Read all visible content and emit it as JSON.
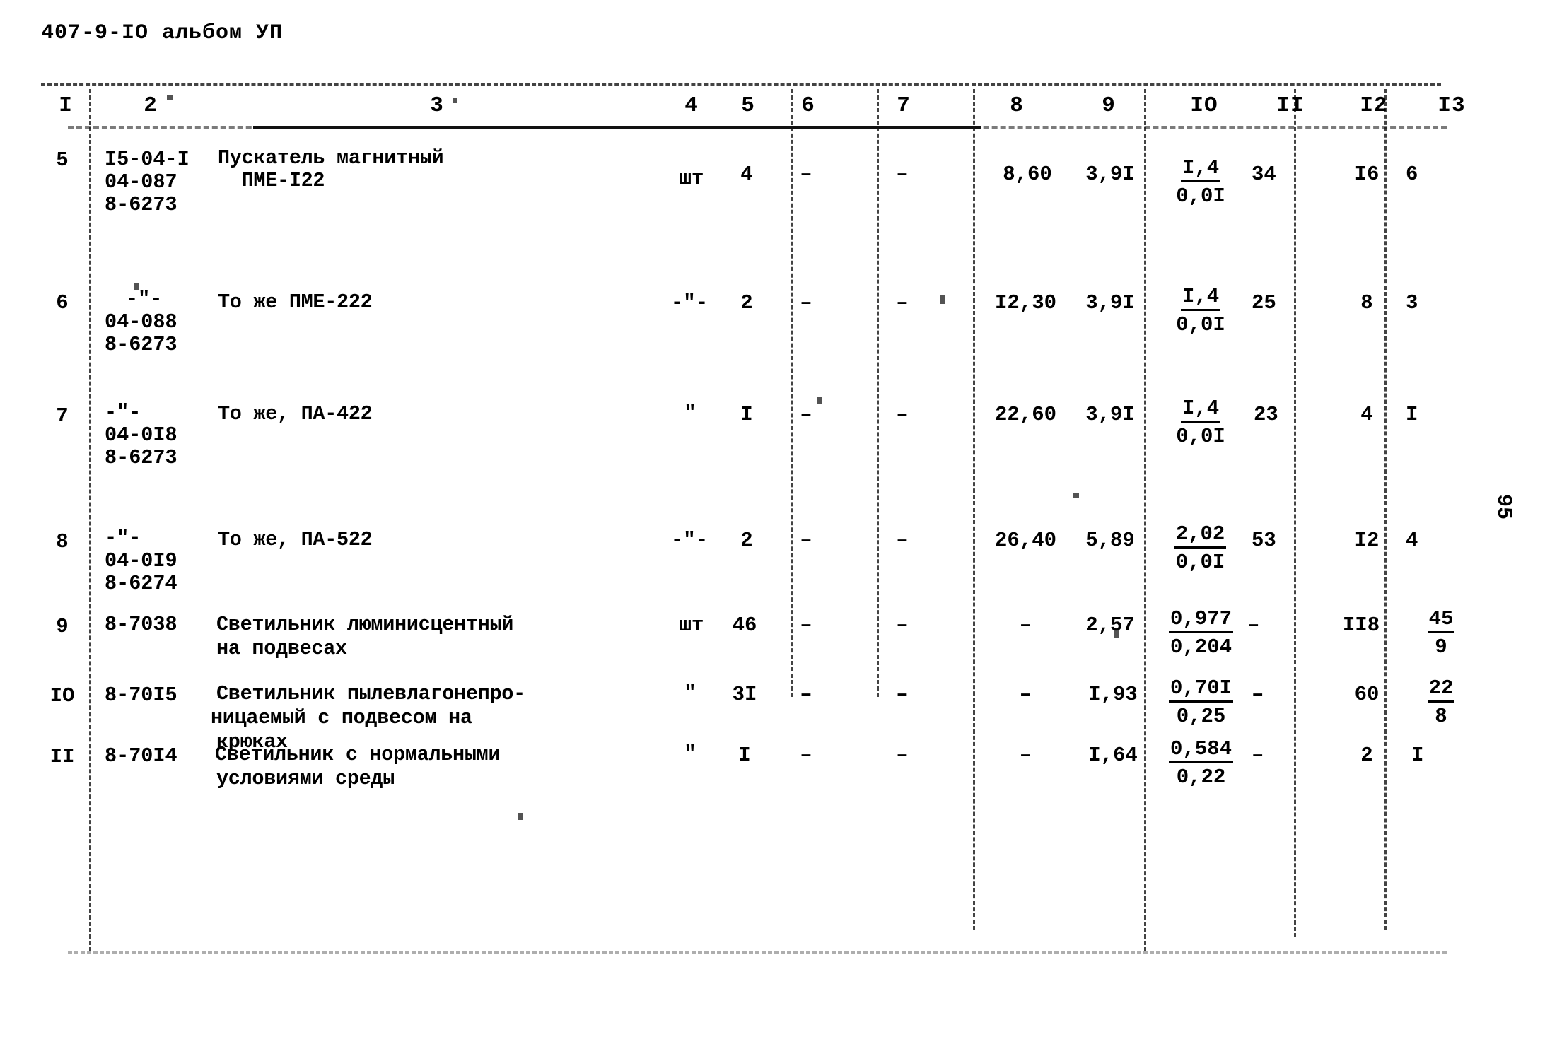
{
  "document": {
    "heading": "407-9-IO альбом УП",
    "page_number": "95"
  },
  "table": {
    "column_headers": [
      "I",
      "2",
      "3",
      "4",
      "5",
      "6",
      "7",
      "8",
      "9",
      "IO",
      "II",
      "I2",
      "I3"
    ],
    "rows": [
      {
        "n": "5",
        "codes": [
          "I5-04-I",
          "04-087",
          "8-6273"
        ],
        "description": [
          "Пускатель магнитный",
          "  ПМЕ-I22"
        ],
        "unit": "шт",
        "qty": "4",
        "c6": "–",
        "c7": "–",
        "c8": "8,60",
        "c9": "3,9I",
        "c10_top": "I,4",
        "c10_bot": "0,0I",
        "c11": "34",
        "c12": "I6",
        "c13": "6"
      },
      {
        "n": "6",
        "codes": [
          "-\"-",
          "04-088",
          "8-6273"
        ],
        "description": [
          "То же ПМЕ-222"
        ],
        "unit": "-\"-",
        "qty": "2",
        "c6": "–",
        "c7": "–",
        "c8": "I2,30",
        "c9": "3,9I",
        "c10_top": "I,4",
        "c10_bot": "0,0I",
        "c11": "25",
        "c12": "8",
        "c13": "3"
      },
      {
        "n": "7",
        "codes": [
          "-\"-",
          "04-0I8",
          "8-6273"
        ],
        "description": [
          "То же, ПА-422"
        ],
        "unit": "\"",
        "qty": "I",
        "c6": "–",
        "c7": "–",
        "c8": "22,60",
        "c9": "3,9I",
        "c10_top": "I,4",
        "c10_bot": "0,0I",
        "c11": "23",
        "c12": "4",
        "c13": "I"
      },
      {
        "n": "8",
        "codes": [
          "-\"-",
          "04-0I9",
          "8-6274"
        ],
        "description": [
          "То же, ПА-522"
        ],
        "unit": "-\"-",
        "qty": "2",
        "c6": "–",
        "c7": "–",
        "c8": "26,40",
        "c9": "5,89",
        "c10_top": "2,02",
        "c10_bot": "0,0I",
        "c11": "53",
        "c12": "I2",
        "c13": "4"
      },
      {
        "n": "9",
        "codes": [
          "8-7038"
        ],
        "description": [
          "Светильник люминисцентный",
          "на подвесах"
        ],
        "unit": "шт",
        "qty": "46",
        "c6": "–",
        "c7": "–",
        "c8": "–",
        "c9": "2,57",
        "c10_top": "0,977",
        "c10_bot": "0,204",
        "c11": "–",
        "c12": "II8",
        "c13_top": "45",
        "c13_bot": "9"
      },
      {
        "n": "IO",
        "codes": [
          "8-70I5"
        ],
        "description": [
          "Светильник пылевлагонепро-",
          "ницаемый с подвесом на",
          "крюках"
        ],
        "unit": "\"",
        "qty": "3I",
        "c6": "–",
        "c7": "–",
        "c8": "–",
        "c9": "I,93",
        "c10_top": "0,70I",
        "c10_bot": "0,25",
        "c11": "–",
        "c12": "60",
        "c13_top": "22",
        "c13_bot": "8"
      },
      {
        "n": "II",
        "codes": [
          "8-70I4"
        ],
        "description": [
          "Светильник с нормальными",
          "условиями среды"
        ],
        "unit": "\"",
        "qty": "I",
        "c6": "–",
        "c7": "–",
        "c8": "–",
        "c9": "I,64",
        "c10_top": "0,584",
        "c10_bot": "0,22",
        "c11": "–",
        "c12": "2",
        "c13": "I"
      }
    ]
  }
}
